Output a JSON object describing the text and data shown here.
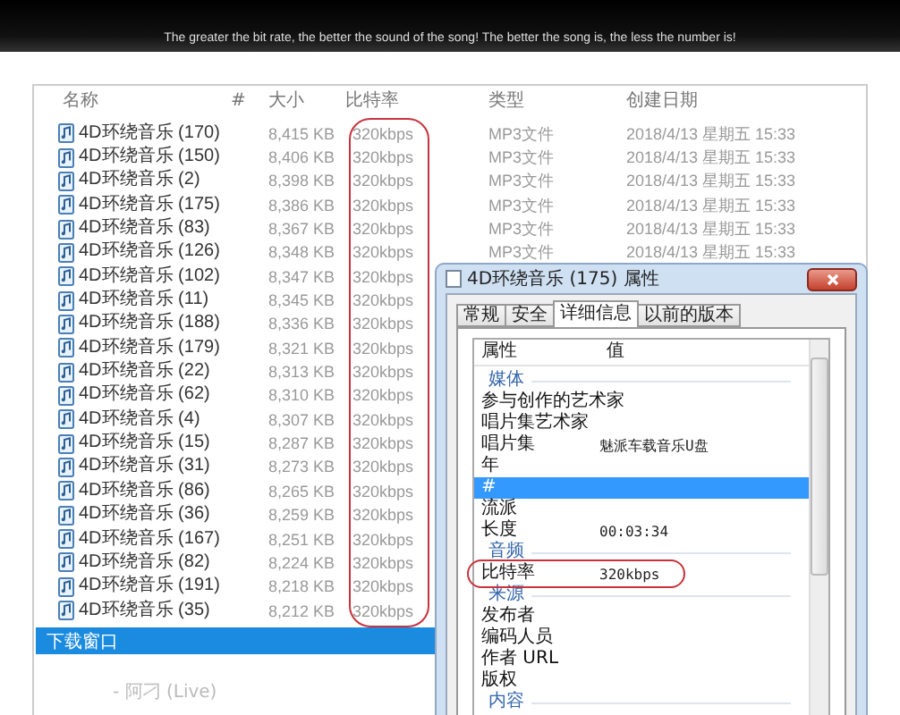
{
  "banner": {
    "caption": "The greater the bit rate, the better the sound of the song! The better the song is, the less the number is!"
  },
  "explorer": {
    "columns": [
      "名称",
      "#",
      "大小",
      "比特率",
      "类型",
      "创建日期"
    ],
    "rows": [
      {
        "name": "4D环绕音乐 (170)",
        "size": "8,415 KB",
        "bitrate": "320kbps",
        "type": "MP3文件",
        "date": "2018/4/13 星期五 15:33"
      },
      {
        "name": "4D环绕音乐 (150)",
        "size": "8,406 KB",
        "bitrate": "320kbps",
        "type": "MP3文件",
        "date": "2018/4/13 星期五 15:33"
      },
      {
        "name": "4D环绕音乐 (2)",
        "size": "8,398 KB",
        "bitrate": "320kbps",
        "type": "MP3文件",
        "date": "2018/4/13 星期五 15:33"
      },
      {
        "name": "4D环绕音乐 (175)",
        "size": "8,386 KB",
        "bitrate": "320kbps",
        "type": "MP3文件",
        "date": "2018/4/13 星期五 15:33"
      },
      {
        "name": "4D环绕音乐 (83)",
        "size": "8,367 KB",
        "bitrate": "320kbps",
        "type": "MP3文件",
        "date": "2018/4/13 星期五 15:33"
      },
      {
        "name": "4D环绕音乐 (126)",
        "size": "8,348 KB",
        "bitrate": "320kbps",
        "type": "MP3文件",
        "date": "2018/4/13 星期五 15:33"
      },
      {
        "name": "4D环绕音乐 (102)",
        "size": "8,347 KB",
        "bitrate": "320kbps"
      },
      {
        "name": "4D环绕音乐 (11)",
        "size": "8,345 KB",
        "bitrate": "320kbps"
      },
      {
        "name": "4D环绕音乐 (188)",
        "size": "8,336 KB",
        "bitrate": "320kbps"
      },
      {
        "name": "4D环绕音乐 (179)",
        "size": "8,321 KB",
        "bitrate": "320kbps"
      },
      {
        "name": "4D环绕音乐 (22)",
        "size": "8,313 KB",
        "bitrate": "320kbps"
      },
      {
        "name": "4D环绕音乐 (62)",
        "size": "8,310 KB",
        "bitrate": "320kbps"
      },
      {
        "name": "4D环绕音乐 (4)",
        "size": "8,307 KB",
        "bitrate": "320kbps"
      },
      {
        "name": "4D环绕音乐 (15)",
        "size": "8,287 KB",
        "bitrate": "320kbps"
      },
      {
        "name": "4D环绕音乐 (31)",
        "size": "8,273 KB",
        "bitrate": "320kbps"
      },
      {
        "name": "4D环绕音乐 (86)",
        "size": "8,265 KB",
        "bitrate": "320kbps"
      },
      {
        "name": "4D环绕音乐 (36)",
        "size": "8,259 KB",
        "bitrate": "320kbps"
      },
      {
        "name": "4D环绕音乐 (167)",
        "size": "8,251 KB",
        "bitrate": "320kbps"
      },
      {
        "name": "4D环绕音乐 (82)",
        "size": "8,224 KB",
        "bitrate": "320kbps"
      },
      {
        "name": "4D环绕音乐 (191)",
        "size": "8,218 KB",
        "bitrate": "320kbps"
      },
      {
        "name": "4D环绕音乐 (35)",
        "size": "8,212 KB",
        "bitrate": "320kbps"
      }
    ]
  },
  "download_window": {
    "title": "下载窗口",
    "track": "- 阿刁 (Live)"
  },
  "dialog": {
    "title": "4D环绕音乐 (175) 属性",
    "tabs": [
      {
        "label": "常规",
        "selected": false
      },
      {
        "label": "安全",
        "selected": false
      },
      {
        "label": "详细信息",
        "selected": true
      },
      {
        "label": "以前的版本",
        "selected": false
      }
    ],
    "columns": [
      "属性",
      "值"
    ],
    "rows": [
      {
        "kind": "group",
        "label": "媒体"
      },
      {
        "kind": "item",
        "label": "参与创作的艺术家",
        "selected": false
      },
      {
        "kind": "item",
        "label": "唱片集艺术家",
        "selected": false
      },
      {
        "kind": "item",
        "label": "唱片集",
        "value": "魅派车载音乐U盘",
        "selected": false
      },
      {
        "kind": "item",
        "label": "年",
        "selected": false
      },
      {
        "kind": "item",
        "label": "#",
        "selected": true
      },
      {
        "kind": "item",
        "label": "流派",
        "selected": false
      },
      {
        "kind": "item",
        "label": "长度",
        "value": "00:03:34",
        "selected": false
      },
      {
        "kind": "group",
        "label": "音频"
      },
      {
        "kind": "item",
        "label": "比特率",
        "value": "320kbps",
        "selected": false
      },
      {
        "kind": "group",
        "label": "来源"
      },
      {
        "kind": "item",
        "label": "发布者",
        "selected": false
      },
      {
        "kind": "item",
        "label": "编码人员",
        "selected": false
      },
      {
        "kind": "item",
        "label": "作者 URL",
        "selected": false
      },
      {
        "kind": "item",
        "label": "版权",
        "selected": false
      },
      {
        "kind": "group",
        "label": "内容"
      }
    ]
  }
}
